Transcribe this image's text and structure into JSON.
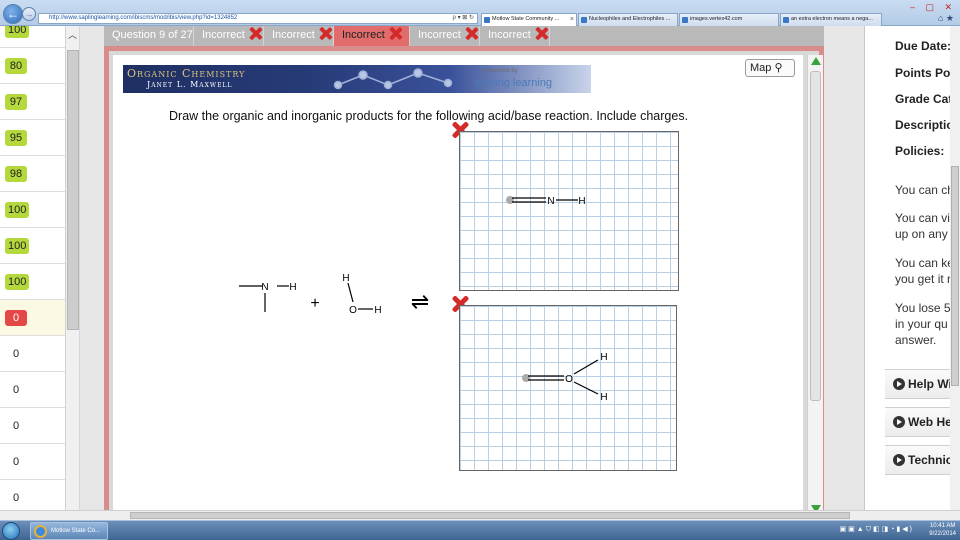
{
  "browser": {
    "address": "http://www.saplinglearning.com/ibiscms/mod/ibis/view.php?id=1324852",
    "address_tools": "ρ ▾ ⊠ ↻",
    "tabs": [
      {
        "label": "Motlow State Community ...",
        "active": true
      },
      {
        "label": "Nucleophiles and Electrophiles ...",
        "active": false
      },
      {
        "label": "images.vertex42.com",
        "active": false
      },
      {
        "label": "an extra electron means a nega...",
        "active": false
      }
    ],
    "window_controls": "– ▢ ✕",
    "toolbar_icons": "⌂ ★"
  },
  "grades": {
    "items": [
      {
        "value": "100",
        "style": "g"
      },
      {
        "value": "80",
        "style": "g"
      },
      {
        "value": "97",
        "style": "g"
      },
      {
        "value": "95",
        "style": "g"
      },
      {
        "value": "98",
        "style": "g"
      },
      {
        "value": "100",
        "style": "g"
      },
      {
        "value": "100",
        "style": "g"
      },
      {
        "value": "100",
        "style": "g"
      },
      {
        "value": "0",
        "style": "r"
      },
      {
        "value": "0",
        "style": "n"
      },
      {
        "value": "0",
        "style": "n"
      },
      {
        "value": "0",
        "style": "n"
      },
      {
        "value": "0",
        "style": "n"
      },
      {
        "value": "0",
        "style": "n"
      }
    ]
  },
  "question_bar": {
    "counter": "Question 9 of 27",
    "tabs": [
      "Incorrect",
      "Incorrect",
      "Incorrect",
      "Incorrect",
      "Incorrect"
    ],
    "current_index": 2
  },
  "banner": {
    "title": "Organic Chemistry",
    "author": "Janet L. Maxwell",
    "presented_by": "presented by",
    "brand": "sapling learning"
  },
  "map_button": "Map",
  "prompt": "Draw the organic and inorganic products for the following acid/base reaction. Include charges.",
  "reaction": {
    "reactant1_atoms": [
      "N",
      "H"
    ],
    "plus": "+",
    "reactant2_atoms": [
      "H",
      "O",
      "H"
    ],
    "arrow": "⇌"
  },
  "product1_atoms": [
    "N",
    "H"
  ],
  "product2_atoms": [
    "O",
    "H",
    "H"
  ],
  "right_panel": {
    "labels": [
      "Due Date:",
      "Points Pos",
      "Grade Cat",
      "Descriptio",
      "Policies:"
    ],
    "texts": [
      "You can ch",
      "You can vi",
      "up on any",
      "You can ke",
      "you get it r",
      "You lose 5",
      "in your qu",
      "answer."
    ],
    "buttons": [
      "Help Wi",
      "Web He",
      "Technica"
    ]
  },
  "taskbar": {
    "window": "Motlow State Co...",
    "clock_time": "10:41 AM",
    "clock_date": "9/22/2014"
  },
  "colors": {
    "correct": "#b5d83c",
    "incorrect": "#e54747",
    "current_tab": "#e26b6b",
    "grid": "#b8cfe4"
  }
}
